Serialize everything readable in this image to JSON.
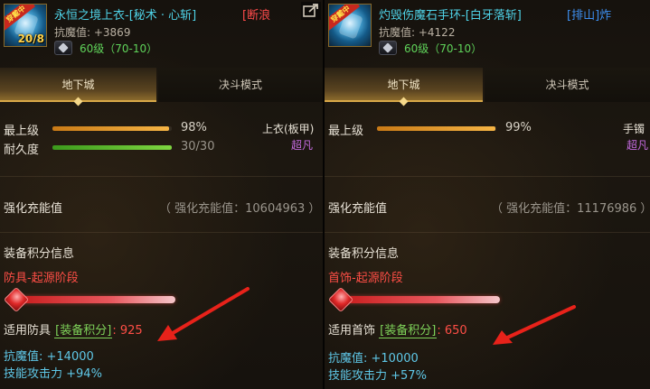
{
  "panels": [
    {
      "icon": {
        "tag": "穿戴中",
        "level": "20/8"
      },
      "item_name": "永恒之境上衣-[秘术 · 心斩]",
      "item_tag": "[断浪",
      "magic_resistance": "抗魔值: +3869",
      "level": "60级（70-10）",
      "tabs": [
        "地下城",
        "决斗模式"
      ],
      "stats": [
        {
          "label": "最上级",
          "value": "98%",
          "fill": 0.98,
          "color": "orange"
        },
        {
          "label": "耐久度",
          "value": "30/30",
          "fill": 1.0,
          "color": "green"
        }
      ],
      "slot_name": "上衣(板甲)",
      "rarity": "超凡",
      "enhance_label": "强化充能值",
      "enhance_value": "（ 强化充能值：10604963 ）",
      "score_title": "装备积分信息",
      "stage": "防具-起源阶段",
      "applicable_prefix": "适用防具",
      "score_key": "[装备积分]",
      "score_value": ": 925",
      "bonus_magic": "抗魔值: +14000",
      "bonus_skill": "技能攻击力 +94%"
    },
    {
      "icon": {
        "tag": "穿戴中",
        "level": ""
      },
      "item_name": "灼毁伤魔石手环-[白牙落斩]",
      "item_tag": "[排山]炸",
      "magic_resistance": "抗魔值: +4122",
      "level": "60级（70-10）",
      "tabs": [
        "地下城",
        "决斗模式"
      ],
      "stats": [
        {
          "label": "最上级",
          "value": "99%",
          "fill": 0.99,
          "color": "orange"
        }
      ],
      "slot_name": "手镯",
      "rarity": "超凡",
      "enhance_label": "强化充能值",
      "enhance_value": "（ 强化充能值：11176986 ）",
      "score_title": "装备积分信息",
      "stage": "首饰-起源阶段",
      "applicable_prefix": "适用首饰",
      "score_key": "[装备积分]",
      "score_value": ": 650",
      "bonus_magic": "抗魔值: +10000",
      "bonus_skill": "技能攻击力 +57%"
    }
  ],
  "colors": {
    "item_name": "#4fd3e8",
    "level": "#5fd35a",
    "stage": "#ff4e46",
    "rarity": "#c56be0",
    "bonus": "#5fc8e8",
    "arrow": "#e8221a"
  }
}
